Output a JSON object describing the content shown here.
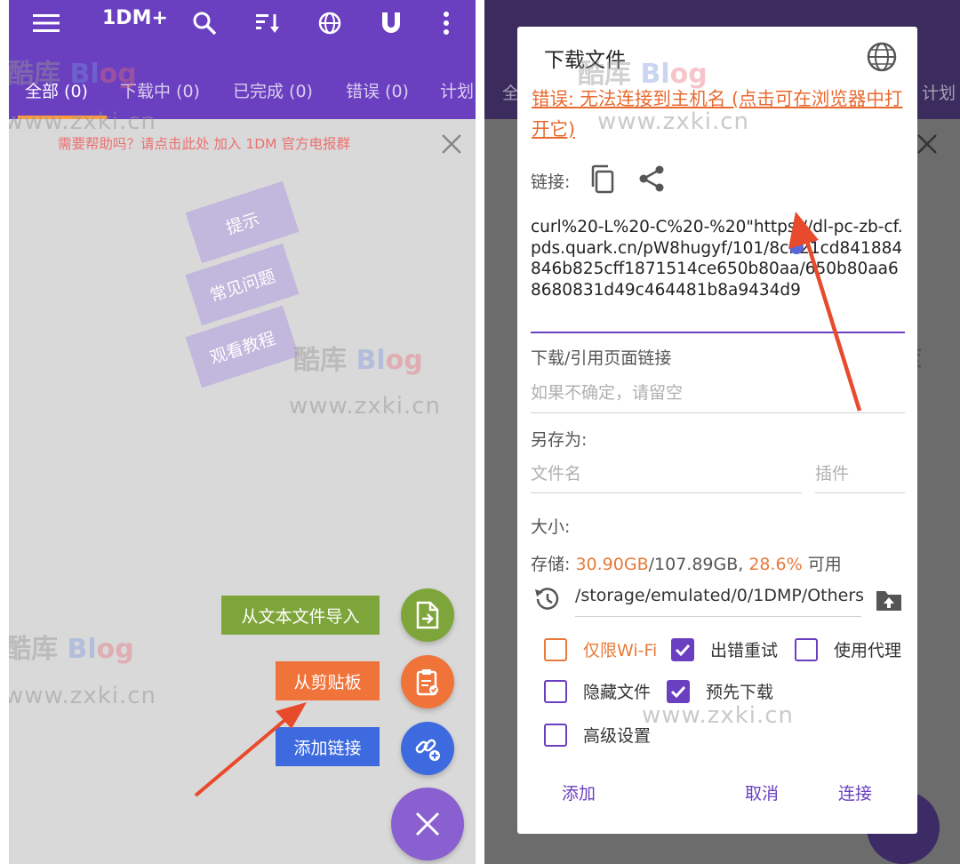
{
  "left": {
    "app_title": "1DM+",
    "tabs": [
      {
        "label": "全部 (0)"
      },
      {
        "label": "下载中 (0)"
      },
      {
        "label": "已完成 (0)"
      },
      {
        "label": "错误 (0)"
      },
      {
        "label": "计划"
      }
    ],
    "help_banner": "需要帮助吗？请点击此处 加入 1DM 官方电报群",
    "stickies": [
      "提示",
      "常见问题",
      "观看教程"
    ],
    "fab_menu": {
      "import_text": "从文本文件导入",
      "clipboard": "从剪贴板",
      "add_link": "添加链接"
    },
    "colors": {
      "appbar": "#6a3fc0",
      "green": "#7ea53a",
      "orange": "#f0733a",
      "blue": "#3e6ae0",
      "purple": "#8a5fd0"
    }
  },
  "right": {
    "tab_fragments": {
      "left": "全",
      "right": "计划"
    },
    "dialog": {
      "title": "下载文件",
      "error": "错误: 无法连接到主机名 (点击可在浏览器中打开它)",
      "link_label": "链接:",
      "url": "curl%20-L%20-C%20-%20\"https://dl-pc-zb-cf.pds.quark.cn/pW8hugyf/101/8cb21cd841884846b825cff1871514ce650b80aa/650b80aa68680831d49c464481b8a9434d9",
      "referer_label": "下载/引用页面链接",
      "referer_placeholder": "如果不确定，请留空",
      "save_as_label": "另存为:",
      "filename_placeholder": "文件名",
      "plugin_placeholder": "插件",
      "size_label": "大小:",
      "storage_label": "存储:",
      "storage_free": "30.90GB",
      "storage_total": "/107.89GB,",
      "storage_percent": "28.6%",
      "storage_available": "可用",
      "path": "/storage/emulated/0/1DMP/Others",
      "options": {
        "wifi_only": "仅限Wi-Fi",
        "retry_on_error": "出错重试",
        "use_proxy": "使用代理",
        "hidden_file": "隐藏文件",
        "pre_download": "预先下载",
        "advanced": "高级设置"
      },
      "buttons": {
        "add": "添加",
        "cancel": "取消",
        "connect": "连接"
      }
    }
  },
  "watermark": {
    "brand_cn": "酷库",
    "brand_en_1": "Bl",
    "brand_en_2": "og",
    "url": "www.zxki.cn"
  }
}
